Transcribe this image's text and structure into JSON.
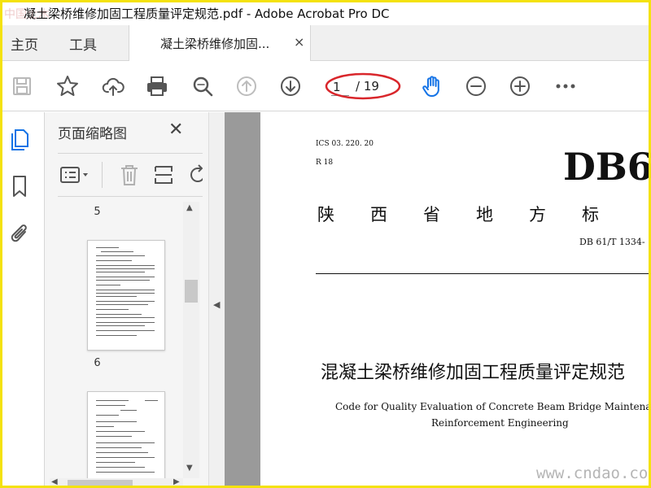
{
  "window": {
    "title": "凝土梁桥维修加固工程质量评定规范.pdf - Adobe Acrobat Pro DC",
    "watermark_top": "中国土木"
  },
  "tabs": {
    "home": "主页",
    "tools": "工具",
    "document": "凝土梁桥维修加固...",
    "close_symbol": "×"
  },
  "toolbar": {
    "icons": [
      "save-icon",
      "star-icon",
      "upload-cloud-icon",
      "print-icon",
      "zoom-search-icon",
      "page-up-icon",
      "page-down-icon",
      "hand-icon",
      "zoom-out-icon",
      "zoom-in-icon",
      "more-icon"
    ],
    "current_page": "1",
    "total_pages": "/ 19",
    "highlight_color": "#d9262b",
    "active_tool_color": "#1473e6"
  },
  "left_rail": {
    "icons": [
      "pages-icon",
      "bookmark-icon",
      "attachment-icon"
    ]
  },
  "thumbnails_panel": {
    "title": "页面缩略图",
    "close_symbol": "✕",
    "tools": [
      "thumbnail-options-icon",
      "delete-icon",
      "crop-icon"
    ],
    "pages": [
      {
        "label": "5"
      },
      {
        "label": "6"
      }
    ]
  },
  "document": {
    "ics": "ICS 03. 220. 20",
    "r_code": "R 18",
    "db_mark": "DB6",
    "province_standard": "陕西省地方标",
    "standard_number": "DB 61/T 1334-",
    "title_cn": "混凝土梁桥维修加固工程质量评定规范",
    "title_en_line1": "Code for Quality Evaluation of Concrete Beam Bridge Maintenance and",
    "title_en_line2": "Reinforcement Engineering"
  },
  "watermark_bottom": "www.cndao.com",
  "colors": {
    "border": "#f4e20d",
    "panel_bg": "#f5f5f5",
    "doc_bg": "#9a9a9a"
  }
}
